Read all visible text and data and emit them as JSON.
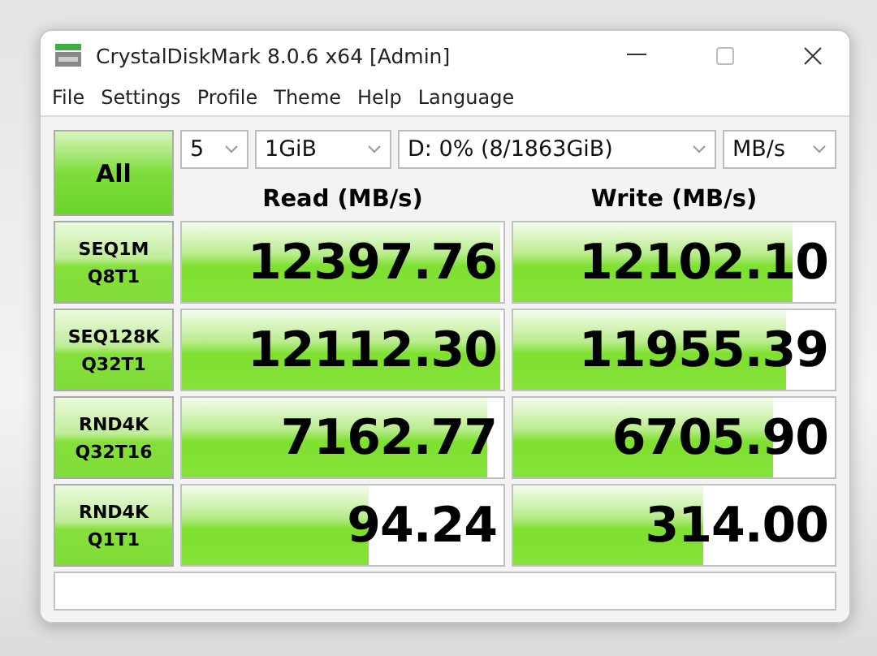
{
  "window": {
    "title": "CrystalDiskMark 8.0.6 x64 [Admin]"
  },
  "menu": [
    "File",
    "Settings",
    "Profile",
    "Theme",
    "Help",
    "Language"
  ],
  "all_button": "All",
  "selects": [
    {
      "value": "5"
    },
    {
      "value": "1GiB"
    },
    {
      "value": "D: 0% (8/1863GiB)"
    },
    {
      "value": "MB/s"
    }
  ],
  "columns": [
    "Read (MB/s)",
    "Write (MB/s)"
  ],
  "rows": [
    {
      "test": "SEQ1M",
      "params": "Q8T1",
      "read": {
        "value": "12397.76",
        "level": 0.99
      },
      "write": {
        "value": "12102.10",
        "level": 0.87
      }
    },
    {
      "test": "SEQ128K",
      "params": "Q32T1",
      "read": {
        "value": "12112.30",
        "level": 0.99
      },
      "write": {
        "value": "11955.39",
        "level": 0.85
      }
    },
    {
      "test": "RND4K",
      "params": "Q32T16",
      "read": {
        "value": "7162.77",
        "level": 0.95
      },
      "write": {
        "value": "6705.90",
        "level": 0.81
      }
    },
    {
      "test": "RND4K",
      "params": "Q1T1",
      "read": {
        "value": "94.24",
        "level": 0.58
      },
      "write": {
        "value": "314.00",
        "level": 0.59
      }
    }
  ]
}
